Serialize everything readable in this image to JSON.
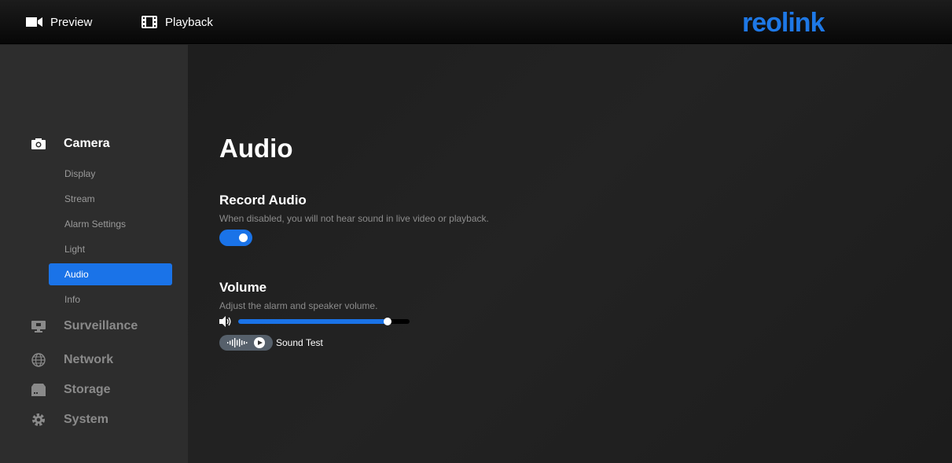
{
  "topbar": {
    "preview_label": "Preview",
    "playback_label": "Playback",
    "logo_text": "reolink"
  },
  "sidebar": {
    "sections": [
      {
        "label": "Camera",
        "icon": "camera-icon",
        "active": true
      },
      {
        "label": "Surveillance",
        "icon": "monitor-icon"
      },
      {
        "label": "Network",
        "icon": "globe-icon"
      },
      {
        "label": "Storage",
        "icon": "storage-icon"
      },
      {
        "label": "System",
        "icon": "gear-icon"
      }
    ],
    "camera_items": [
      "Display",
      "Stream",
      "Alarm Settings",
      "Light",
      "Audio",
      "Info"
    ],
    "active_item": "Audio"
  },
  "main": {
    "title": "Audio",
    "record_audio": {
      "heading": "Record Audio",
      "description": "When disabled, you will not hear sound in live video or playback.",
      "enabled": true
    },
    "volume": {
      "heading": "Volume",
      "description": "Adjust the alarm and speaker volume.",
      "level": 0.87
    },
    "sound_test_label": "Sound Test"
  },
  "colors": {
    "accent": "#1a73e8",
    "logo": "#1e78e6",
    "sidebar_bg": "#2d2d2d"
  }
}
